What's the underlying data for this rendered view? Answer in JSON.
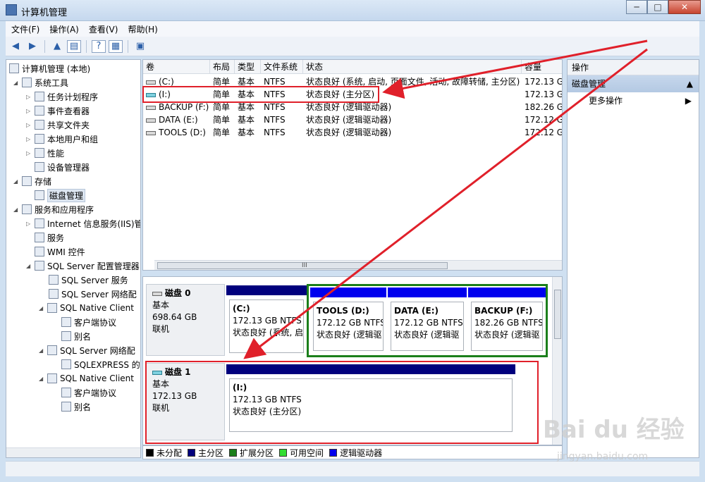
{
  "window": {
    "title": "计算机管理",
    "min": "─",
    "max": "□",
    "close": "✕"
  },
  "menu": [
    "文件(F)",
    "操作(A)",
    "查看(V)",
    "帮助(H)"
  ],
  "toolbar_icons": [
    "back-arrow-icon",
    "forward-arrow-icon",
    "folder-up-icon",
    "console-tree-icon",
    "help-icon",
    "properties-icon",
    "export-icon"
  ],
  "tree": [
    {
      "label": "计算机管理 (本地)"
    },
    {
      "label": "系统工具"
    },
    {
      "label": "任务计划程序"
    },
    {
      "label": "事件查看器"
    },
    {
      "label": "共享文件夹"
    },
    {
      "label": "本地用户和组"
    },
    {
      "label": "性能"
    },
    {
      "label": "设备管理器"
    },
    {
      "label": "存储"
    },
    {
      "label": "磁盘管理"
    },
    {
      "label": "服务和应用程序"
    },
    {
      "label": "Internet 信息服务(IIS)管"
    },
    {
      "label": "服务"
    },
    {
      "label": "WMI 控件"
    },
    {
      "label": "SQL Server 配置管理器"
    },
    {
      "label": "SQL Server 服务"
    },
    {
      "label": "SQL Server 网络配"
    },
    {
      "label": "SQL Native Client"
    },
    {
      "label": "客户端协议"
    },
    {
      "label": "别名"
    },
    {
      "label": "SQL Server 网络配"
    },
    {
      "label": "SQLEXPRESS 的"
    },
    {
      "label": "SQL Native Client"
    },
    {
      "label": "客户端协议"
    },
    {
      "label": "别名"
    }
  ],
  "volumes": {
    "headers": [
      "卷",
      "布局",
      "类型",
      "文件系统",
      "状态",
      "容量"
    ],
    "rows": [
      [
        "(C:)",
        "简单",
        "基本",
        "NTFS",
        "状态良好 (系统, 启动, 页面文件, 活动, 故障转储, 主分区)",
        "172.13 G"
      ],
      [
        "(I:)",
        "简单",
        "基本",
        "NTFS",
        "状态良好 (主分区)",
        "172.13 G"
      ],
      [
        "BACKUP (F:)",
        "简单",
        "基本",
        "NTFS",
        "状态良好 (逻辑驱动器)",
        "182.26 G"
      ],
      [
        "DATA (E:)",
        "简单",
        "基本",
        "NTFS",
        "状态良好 (逻辑驱动器)",
        "172.12 G"
      ],
      [
        "TOOLS (D:)",
        "简单",
        "基本",
        "NTFS",
        "状态良好 (逻辑驱动器)",
        "172.12 G"
      ]
    ],
    "scroll_grip": "III"
  },
  "disks": [
    {
      "name": "磁盘 0",
      "type": "基本",
      "size": "698.64 GB",
      "state": "联机",
      "partitions": [
        {
          "name": "(C:)",
          "size": "172.13 GB NTFS",
          "status": "状态良好 (系统, 启"
        },
        {
          "name": "TOOLS  (D:)",
          "size": "172.12 GB NTFS",
          "status": "状态良好 (逻辑驱"
        },
        {
          "name": "DATA  (E:)",
          "size": "172.12 GB NTFS",
          "status": "状态良好 (逻辑驱"
        },
        {
          "name": "BACKUP  (F:)",
          "size": "182.26 GB NTFS",
          "status": "状态良好 (逻辑驱"
        }
      ]
    },
    {
      "name": "磁盘 1",
      "type": "基本",
      "size": "172.13 GB",
      "state": "联机",
      "partitions": [
        {
          "name": "(I:)",
          "size": "172.13 GB NTFS",
          "status": "状态良好 (主分区)"
        }
      ]
    }
  ],
  "legend": [
    {
      "label": "未分配",
      "color": "#000000"
    },
    {
      "label": "主分区",
      "color": "#00007d"
    },
    {
      "label": "扩展分区",
      "color": "#1b7f1b"
    },
    {
      "label": "可用空间",
      "color": "#33dd33"
    },
    {
      "label": "逻辑驱动器",
      "color": "#0000ee"
    }
  ],
  "actions": {
    "header": "操作",
    "section": "磁盘管理",
    "more": "更多操作"
  },
  "colors": {
    "annotation": "#e0202a",
    "primary_partition": "#00007d",
    "extended_partition": "#1b7f1b"
  },
  "watermark": {
    "brand": "Bai du 经验",
    "url": "jingyan.baidu.com"
  }
}
